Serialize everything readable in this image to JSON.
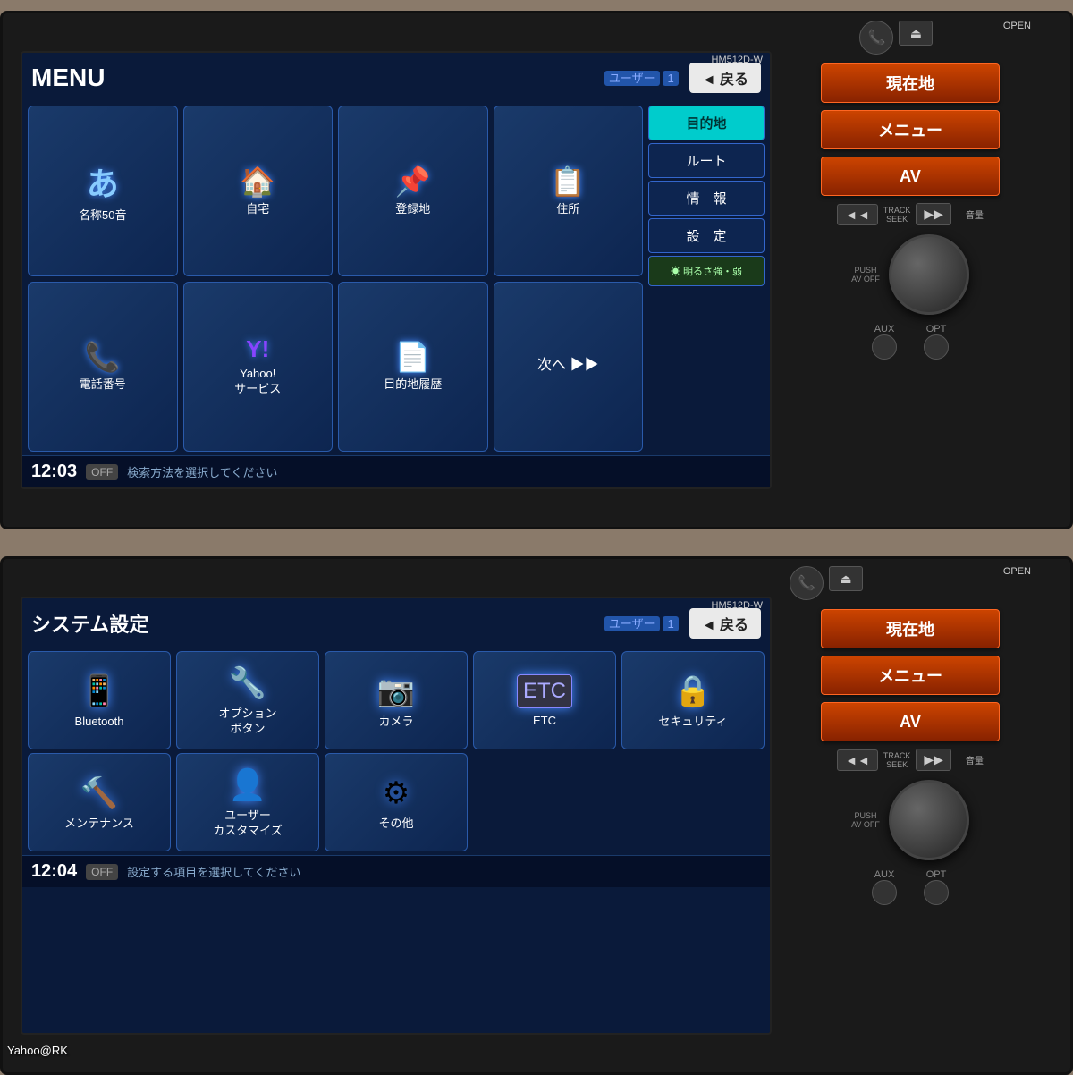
{
  "unit_top": {
    "model": "HM512D-W",
    "open_label": "OPEN",
    "title": "MENU",
    "user": "ユーザー",
    "user_num": "1",
    "back_btn": "◄ 戻る",
    "time": "12:03",
    "off_badge": "OFF",
    "status_text": "検索方法を選択してください",
    "menu_items": [
      {
        "icon": "あ",
        "label": "名称50音"
      },
      {
        "icon": "🏠",
        "label": "自宅"
      },
      {
        "icon": "📌",
        "label": "登録地"
      },
      {
        "icon": "📋",
        "label": "住所"
      },
      {
        "icon": "📞",
        "label": "電話番号"
      },
      {
        "icon": "Y!",
        "label": "Yahoo!\nサービス"
      },
      {
        "icon": "📄",
        "label": "目的地履歴"
      },
      {
        "icon": "次へ ▶▶",
        "label": ""
      }
    ],
    "dropdown": [
      {
        "label": "目的地",
        "active": true
      },
      {
        "label": "ルート",
        "active": false
      },
      {
        "label": "情　報",
        "active": false
      },
      {
        "label": "設　定",
        "active": false
      },
      {
        "label": "☀ 明るさ強・弱",
        "active": false,
        "brightness": true
      }
    ]
  },
  "unit_bottom": {
    "model": "HM512D-W",
    "open_label": "OPEN",
    "title": "システム設定",
    "user": "ユーザー",
    "user_num": "1",
    "back_btn": "◄ 戻る",
    "time": "12:04",
    "off_badge": "OFF",
    "status_text": "設定する項目を選択してください",
    "sys_items_row1": [
      {
        "icon": "📱",
        "label": "Bluetooth"
      },
      {
        "icon": "🔧",
        "label": "オプション\nボタン"
      },
      {
        "icon": "📷",
        "label": "カメラ"
      },
      {
        "icon": "🏷",
        "label": "ETC"
      },
      {
        "icon": "🔒",
        "label": "セキュリティ"
      }
    ],
    "sys_items_row2": [
      {
        "icon": "🔨",
        "label": "メンテナンス"
      },
      {
        "icon": "👤",
        "label": "ユーザー\nカスタマイズ"
      },
      {
        "icon": "⚙",
        "label": "その他"
      }
    ]
  },
  "right_panel": {
    "phone_icon": "📞",
    "eject_icon": "⏏",
    "btn_genzaichi": "現在地",
    "btn_menu": "メニュー",
    "btn_av": "AV",
    "track_seek_label": "TRACK\nSEEK",
    "track_prev": "◄◄",
    "track_next": "▶▶",
    "push_av_off": "PUSH\nAV OFF",
    "volume_label": "音量",
    "aux_label": "AUX",
    "opt_label": "OPT"
  },
  "watermark": "Yahoo@RK"
}
